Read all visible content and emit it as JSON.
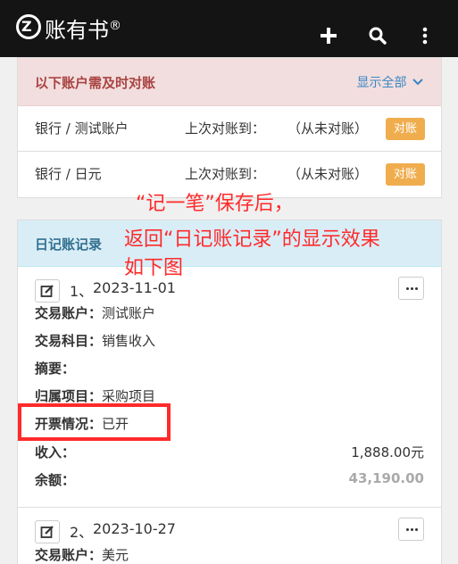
{
  "app": {
    "logo_glyph": "Z",
    "title": "账有书",
    "reg": "®"
  },
  "toolbar": {
    "icons": [
      "plus-icon",
      "search-icon",
      "more-vertical-icon"
    ]
  },
  "reconciliation": {
    "title": "以下账户需及时对账",
    "show_all": "显示全部",
    "rows": [
      {
        "account": "银行 / 测试账户",
        "last_label": "上次对账到：",
        "last_value": "（从未对账）",
        "button": "对账"
      },
      {
        "account": "银行 / 日元",
        "last_label": "上次对账到：",
        "last_value": "（从未对账）",
        "button": "对账"
      }
    ]
  },
  "journal": {
    "title": "日记账记录",
    "entries": [
      {
        "no": "1、",
        "date": "2023-11-01",
        "account_label": "交易账户：",
        "account": "测试账户",
        "subject_label": "交易科目：",
        "subject": "销售收入",
        "summary_label": "摘要：",
        "summary": "",
        "project_label": "归属项目：",
        "project": "采购项目",
        "invoice_label": "开票情况：",
        "invoice": "已开",
        "income_label": "收入：",
        "income": "1,888.00元",
        "balance_label": "余额：",
        "balance": "43,190.00"
      },
      {
        "no": "2、",
        "date": "2023-10-27",
        "account_label": "交易账户：",
        "account": "美元"
      }
    ]
  },
  "annotation": {
    "line1": "“记一笔”保存后，",
    "line2": "返回“日记账记录”的显示效果",
    "line3": "如下图",
    "color": "#ff2a2a"
  },
  "colors": {
    "topbar": "#141414",
    "recon_head_bg": "#f2dede",
    "recon_head_text": "#a94442",
    "journal_head_bg": "#d9edf7",
    "journal_head_text": "#31708f",
    "recon_button": "#f0ad4e",
    "link": "#3a87c4"
  }
}
